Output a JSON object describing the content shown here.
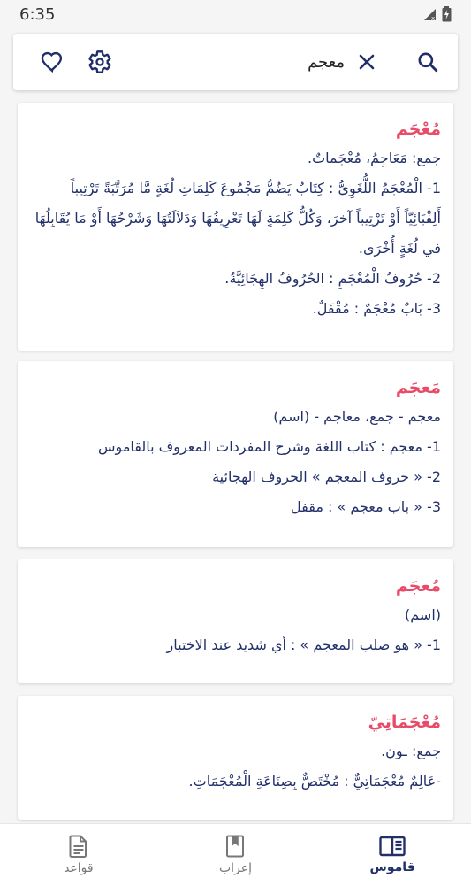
{
  "status_bar": {
    "time": "6:35",
    "icons": [
      "signal-icon",
      "battery-icon"
    ]
  },
  "search": {
    "value": "معجم",
    "icons": [
      "search-icon",
      "clear-icon",
      "settings-gear-icon",
      "favorite-heart-icon"
    ]
  },
  "results": [
    {
      "headword": "مُعْجَم",
      "lines": [
        "جمع: مَعَاجِمُ، مُعْجَماتٌ.",
        "1- الْمُعْجَمُ اللُّغَوِيُّ : كِتَابٌ يَضُمُّ مَجْمُوعَ كَلِمَاتِ لُغَةٍ مَّا مُرَتَّبَةً تَرْتِيباً أَلِفْبَائِيّاً أَوْ تَرْتِيباً آخرَ، وَكُلُّ كَلِمَةٍ لَهَا تَعْرِيفُهَا وَدَلاَلَتُهَا وَشَرْحُهَا أَوْ مَا يُقَابِلُهَا في لُغَةٍ أُخْرَى.",
        "2- حُرُوفُ الْمُعْجَمِ : الحُرُوفُ الهِجَائِيَّةُ.",
        "3- بَابٌ مُعْجَمٌ : مُقْفَلٌ."
      ]
    },
    {
      "headword": "مَعجَم",
      "lines": [
        "معجم - جمع، معاجم - (اسم)",
        "1- معجم : كتاب اللغة وشرح المفردات المعروف بالقاموس",
        "2- « حروف المعجم » الحروف الهجائية",
        "3- « باب معجم » : مقفل"
      ]
    },
    {
      "headword": "مُعجَم",
      "lines": [
        "(اسم)",
        "1- « هو صلب المعجم » : أي شديد عند الاختبار"
      ]
    },
    {
      "headword": "مُعْجَمَاتِيّ",
      "lines": [
        "جمع: ـون.",
        "-عَالِمٌ مُعْجَمَاتِيٌّ : مُخْتَصٌّ بِصِنَاعَةِ الْمُعْجَمَاتِ."
      ]
    }
  ],
  "bottom_nav": {
    "items": [
      {
        "label": "قاموس",
        "icon": "dictionary-book-icon",
        "active": true
      },
      {
        "label": "إعراب",
        "icon": "bookmark-book-icon",
        "active": false
      },
      {
        "label": "قواعد",
        "icon": "document-icon",
        "active": false
      }
    ]
  },
  "colors": {
    "headword": "#e84a67",
    "text": "#22306a",
    "accent": "#1f2d6b",
    "background": "#f5f5f5"
  }
}
